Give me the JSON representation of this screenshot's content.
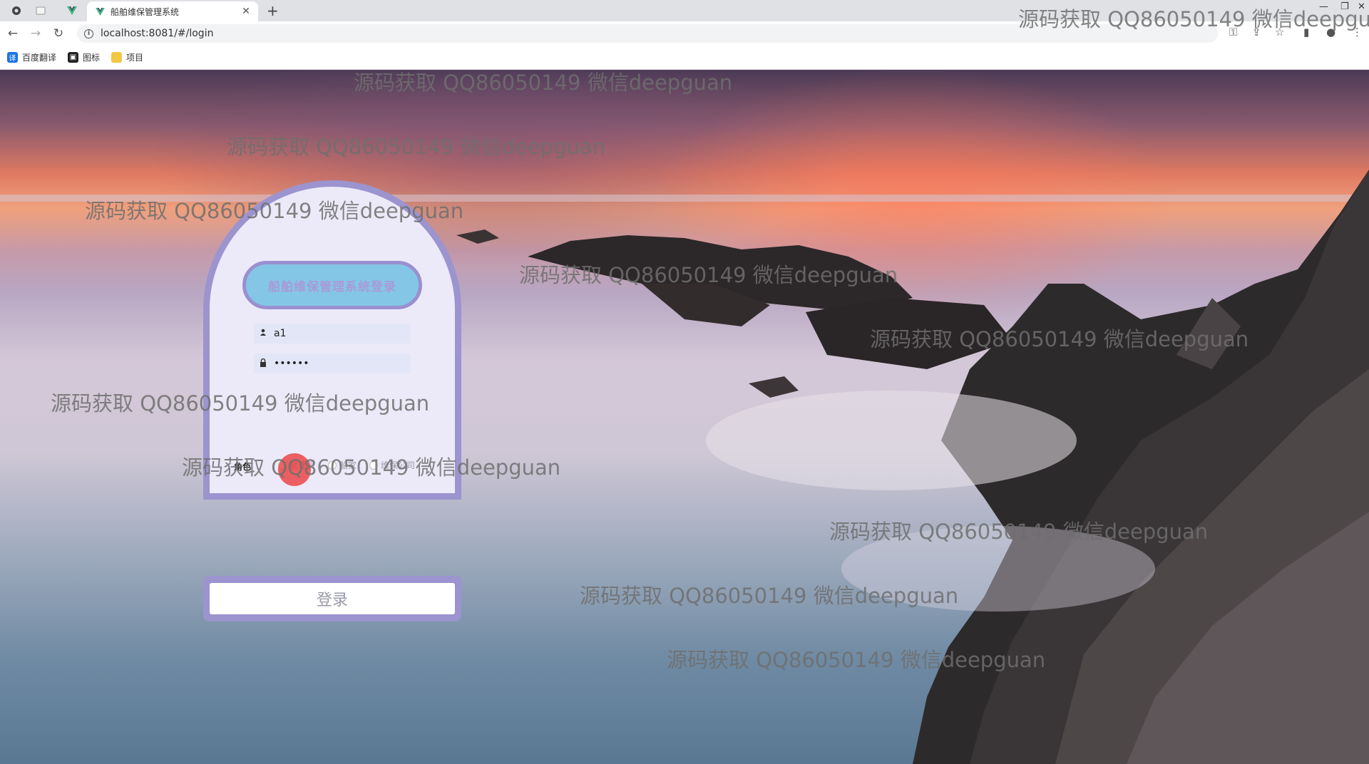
{
  "browser": {
    "tab_title": "船舶维保管理系统",
    "url": "localhost:8081/#/login",
    "bookmarks": [
      {
        "label": "百度翻译",
        "icon": "translate-icon",
        "color": "#1a73e8"
      },
      {
        "label": "图标",
        "icon": "image-icon",
        "color": "#222222"
      },
      {
        "label": "项目",
        "icon": "folder-icon",
        "color": "#f2c744"
      }
    ]
  },
  "login": {
    "title": "船舶维保管理系统登录",
    "username_value": "a1",
    "password_value": "••••••",
    "role_label": "角色",
    "roles": [
      "管理员",
      "船家",
      "维保公司"
    ],
    "login_button": "登录"
  },
  "watermark": {
    "text": "源码获取 QQ86050149 微信deepguan",
    "text_cut": "源码获取 QQ86050149 微信deepgu"
  },
  "colors": {
    "card_border": "#9b94cf",
    "card_bg": "#eceaf9",
    "title_pill_bg": "#84c6e6",
    "title_text": "#a99ad8"
  }
}
